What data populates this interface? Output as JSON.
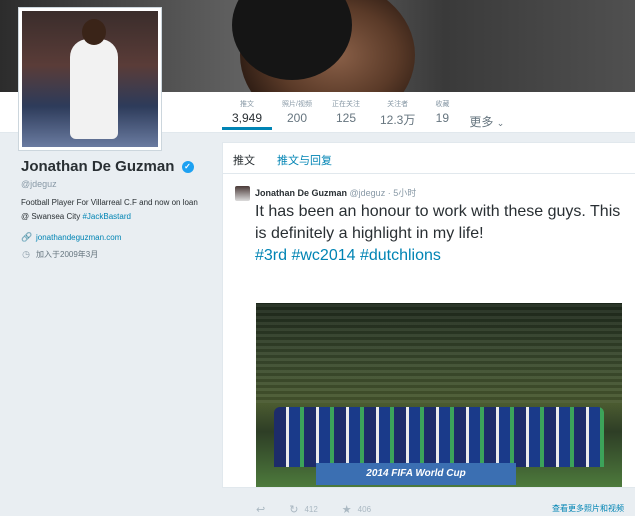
{
  "profile": {
    "name": "Jonathan De Guzman",
    "handle": "@jdeguz",
    "bio_text": "Football Player For Villarreal C.F and now on loan @ Swansea City ",
    "bio_hashtag": "#JackBastard",
    "website": "jonathandeguzman.com",
    "joined": "加入于2009年3月",
    "verified": true
  },
  "stats": [
    {
      "label": "推文",
      "value": "3,949",
      "active": true
    },
    {
      "label": "照片/视频",
      "value": "200",
      "active": false
    },
    {
      "label": "正在关注",
      "value": "125",
      "active": false
    },
    {
      "label": "关注者",
      "value": "12.3万",
      "active": false
    },
    {
      "label": "收藏",
      "value": "19",
      "active": false
    }
  ],
  "more_label": "更多",
  "tabs": [
    {
      "label": "推文"
    },
    {
      "label": "推文与回复"
    }
  ],
  "tweet": {
    "author": "Jonathan De Guzman",
    "handle": "@jdeguz",
    "time": "· 5小时",
    "text": "It has been an honour to work with these guys. This is definitely a highlight in my life!",
    "hashtags": "#3rd #wc2014 #dutchlions",
    "photo_banner": "2014 FIFA World Cup",
    "retweets": "412",
    "favorites": "406",
    "view_more": "查看更多照片和视频"
  },
  "icons": {
    "reply": "reply-icon",
    "retweet": "retweet-icon",
    "favorite": "star-icon",
    "link": "link-icon",
    "calendar": "calendar-icon"
  },
  "colors": {
    "accent": "#0084b4",
    "verified": "#1da1f2"
  }
}
